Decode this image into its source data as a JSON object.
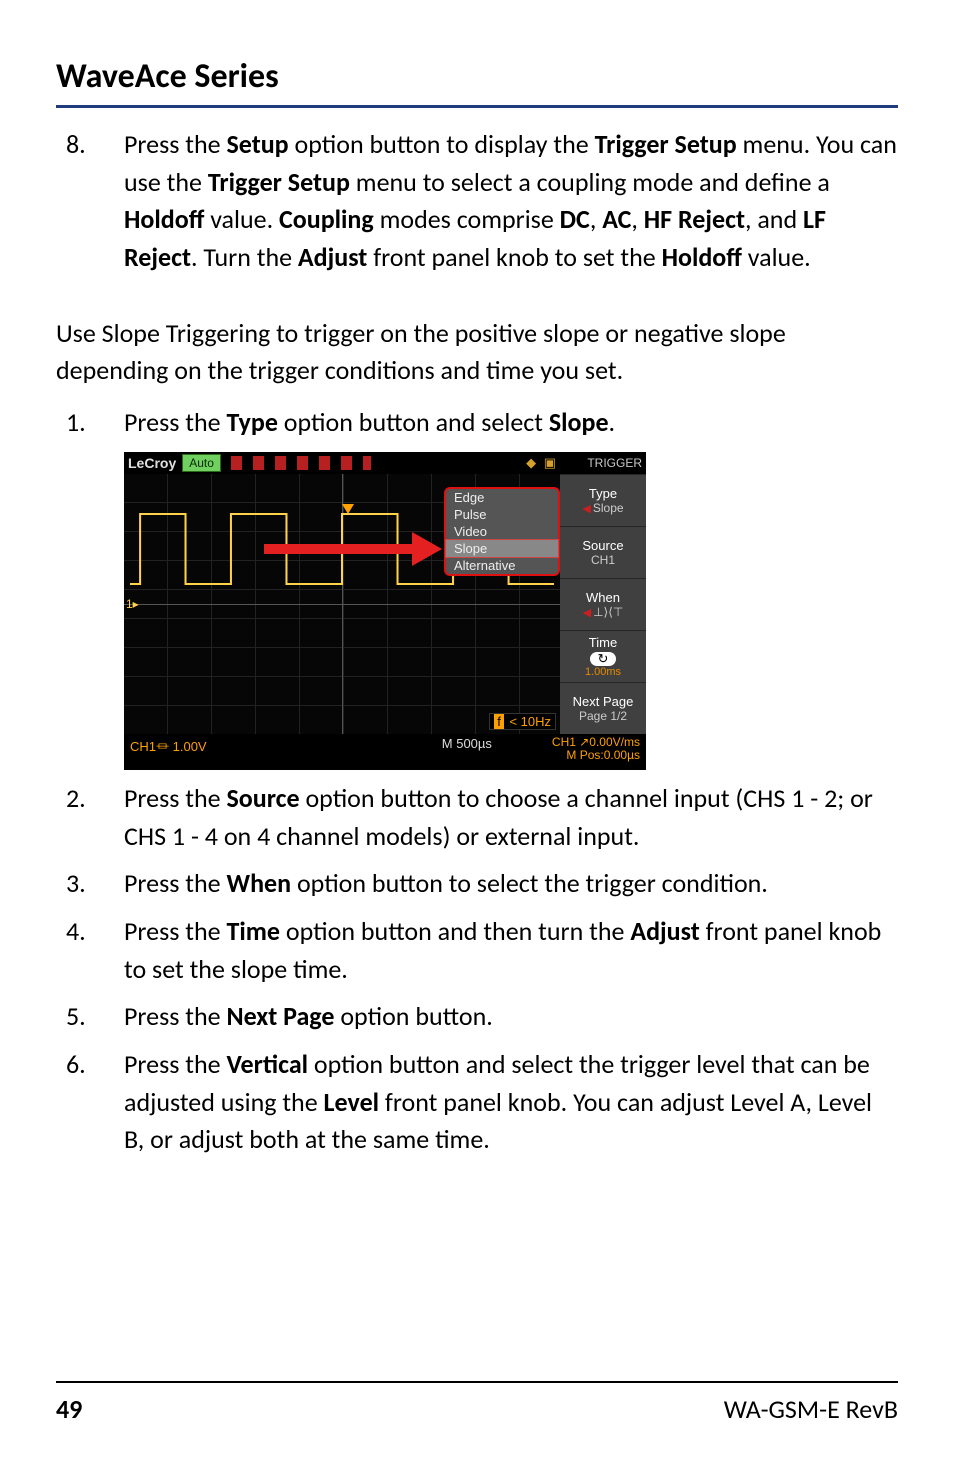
{
  "header": {
    "title": "WaveAce Series"
  },
  "section_a": {
    "step8_num": "8.",
    "step8_part_a": "Press the ",
    "step8_b1": "Setup",
    "step8_part_b": " option button to display the ",
    "step8_b2": "Trigger Setup",
    "step8_part_c": " menu. You can use the ",
    "step8_b3": "Trigger Setup",
    "step8_part_d": " menu to select a coupling mode and define a ",
    "step8_b4": "Holdoff",
    "step8_part_e": " value. ",
    "step8_b5": "Coupling",
    "step8_part_f": " modes comprise ",
    "step8_b6": "DC",
    "step8_part_g": ", ",
    "step8_b7": "AC",
    "step8_part_h": ", ",
    "step8_b8": "HF Reject",
    "step8_part_i": ", and ",
    "step8_b9": "LF Reject",
    "step8_part_j": ". Turn the ",
    "step8_b10": "Adjust",
    "step8_part_k": " front panel knob to set the ",
    "step8_b11": "Holdoff",
    "step8_part_l": " value."
  },
  "intro": "Use Slope Triggering to trigger on the positive slope or negative slope depending on the trigger conditions and time you set.",
  "steps": {
    "s1_num": "1.",
    "s1_a": "Press the ",
    "s1_b1": "Type",
    "s1_b": " option button and select ",
    "s1_b2": "Slope",
    "s1_c": ".",
    "s2_num": "2.",
    "s2_a": "Press the ",
    "s2_b1": "Source",
    "s2_b": " option button to choose a channel input (CHS 1 - 2; or CHS 1 - 4 on 4 channel models) or external input.",
    "s3_num": "3.",
    "s3_a": "Press the ",
    "s3_b1": "When",
    "s3_b": " option button to select the trigger condition.",
    "s4_num": "4.",
    "s4_a": "Press the ",
    "s4_b1": "Time",
    "s4_b": " option button and then turn the ",
    "s4_b2": "Adjust",
    "s4_c": " front panel knob to set the slope time.",
    "s5_num": "5.",
    "s5_a": "Press the ",
    "s5_b1": "Next Page",
    "s5_b": " option button.",
    "s6_num": "6.",
    "s6_a": "Press the ",
    "s6_b1": "Vertical",
    "s6_b": " option button and select the trigger level that can be adjusted using the ",
    "s6_b2": "Level",
    "s6_c": " front panel knob. You can adjust Level A, Level B, or adjust both at the same time."
  },
  "scope": {
    "brand": "LeCroy",
    "auto": "Auto",
    "trigger_title": "TRIGGER",
    "menu": {
      "type_label": "Type",
      "type_value": "Slope",
      "source_label": "Source",
      "source_value": "CH1",
      "when_label": "When",
      "when_glyph": "⊥⟩⟨⊤",
      "time_label": "Time",
      "time_icon": "↻",
      "time_value": "1.00ms",
      "next_label": "Next Page",
      "page_label": "Page 1/2"
    },
    "popup": {
      "opt1": "Edge",
      "opt2": "Pulse",
      "opt3": "Video",
      "opt_sel": "Slope",
      "opt5": "Alternative"
    },
    "ch1_marker": "1▸",
    "freq": {
      "prefix": "f",
      "text": " < 10Hz"
    },
    "status": {
      "ch1": "CH1⏛ 1.00V",
      "timebase": "M 500µs",
      "right_a": "CH1 ↗0.00V/ms",
      "right_b": "M Pos:0.00µs"
    }
  },
  "footer": {
    "page": "49",
    "code": "WA-GSM-E RevB"
  }
}
